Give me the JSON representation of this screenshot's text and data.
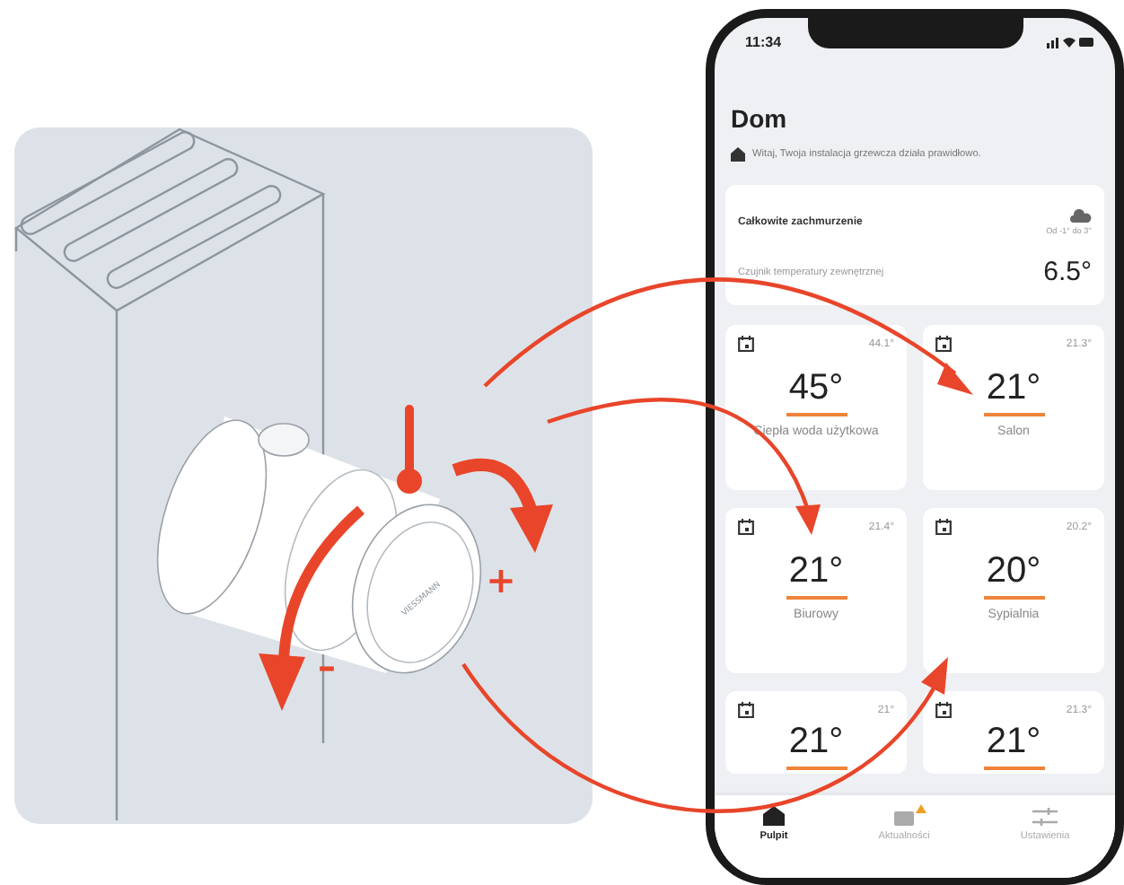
{
  "illustration": {
    "device_logo": "VIESSMANN",
    "plus": "+",
    "minus": "–"
  },
  "status_bar": {
    "time": "11:34"
  },
  "header": {
    "title": "Dom",
    "message": "Witaj, Twoja instalacja grzewcza działa prawidłowo."
  },
  "weather": {
    "condition": "Całkowite zachmurzenie",
    "range": "Od -1° do 3°",
    "sensor_label": "Czujnik temperatury zewnętrznej",
    "sensor_value": "6.5°"
  },
  "tiles": [
    {
      "current": "44.1°",
      "setpoint": "45°",
      "name": "Ciepła woda użytkowa"
    },
    {
      "current": "21.3°",
      "setpoint": "21°",
      "name": "Salon"
    },
    {
      "current": "21.4°",
      "setpoint": "21°",
      "name": "Biurowy"
    },
    {
      "current": "20.2°",
      "setpoint": "20°",
      "name": "Sypialnia"
    },
    {
      "current": "21°",
      "setpoint": "21°"
    },
    {
      "current": "21.3°",
      "setpoint": "21°"
    }
  ],
  "tab_bar": [
    {
      "kind": "home",
      "label": "Pulpit",
      "selected": true,
      "alert": false
    },
    {
      "kind": "news",
      "label": "Aktualności",
      "selected": false,
      "alert": true
    },
    {
      "kind": "settings",
      "label": "Ustawienia",
      "selected": false,
      "alert": false
    }
  ]
}
